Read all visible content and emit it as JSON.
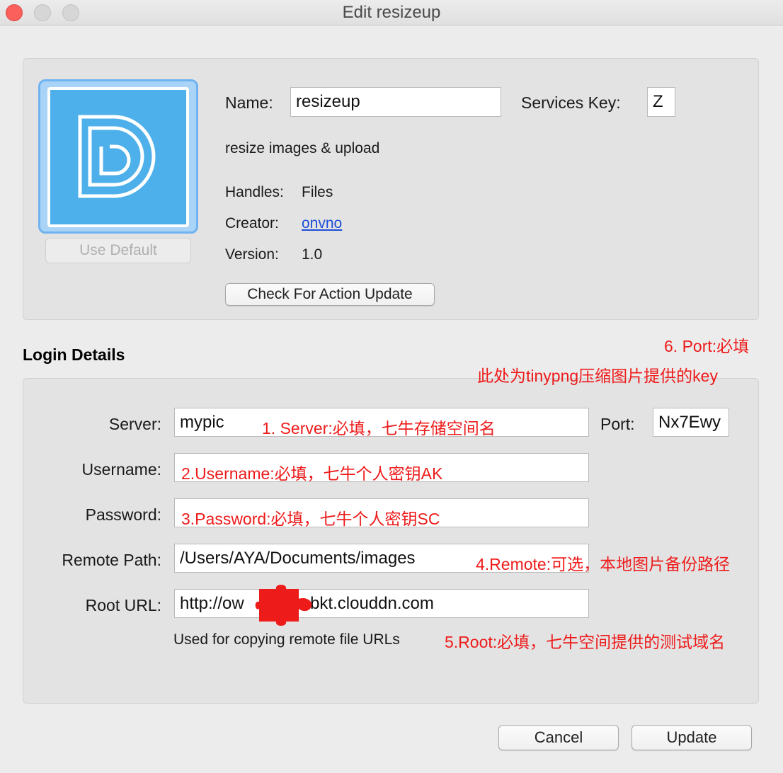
{
  "window": {
    "title": "Edit resizeup"
  },
  "action": {
    "use_default": "Use Default",
    "name_label": "Name:",
    "name_value": "resizeup",
    "services_key_label": "Services Key:",
    "services_key_value": "Z",
    "description": "resize images & upload",
    "handles_label": "Handles:",
    "handles_value": "Files",
    "creator_label": "Creator:",
    "creator_value": "onvno",
    "version_label": "Version:",
    "version_value": "1.0",
    "check_update": "Check For Action Update"
  },
  "login": {
    "title": "Login Details",
    "server_label": "Server:",
    "server_value": "mypic",
    "port_label": "Port:",
    "port_value": "Nx7Ewy",
    "username_label": "Username:",
    "password_label": "Password:",
    "remote_path_label": "Remote Path:",
    "remote_path_value": "/Users/AYA/Documents/images",
    "root_url_label": "Root URL:",
    "root_url_value": "http://ow          9r.bkt.clouddn.com",
    "root_url_hint": "Used for copying remote file URLs"
  },
  "annotations": {
    "server": "1. Server:必填，七牛存储空间名",
    "username": "2.Username:必填，七牛个人密钥AK",
    "password": "3.Password:必填，七牛个人密钥SC",
    "remote": "4.Remote:可选，本地图片备份路径",
    "root": "5.Root:必填，七牛空间提供的测试域名",
    "port_line1": "6. Port:必填",
    "port_line2": "此处为tinypng压缩图片提供的key"
  },
  "footer": {
    "cancel": "Cancel",
    "update": "Update"
  },
  "colors": {
    "annotation": "#ee1b1b",
    "icon_bg": "#4eb0ea",
    "link": "#1d4ed8"
  },
  "icons": {
    "app_icon": "letter-d-logo",
    "redaction": "puzzle-piece"
  }
}
